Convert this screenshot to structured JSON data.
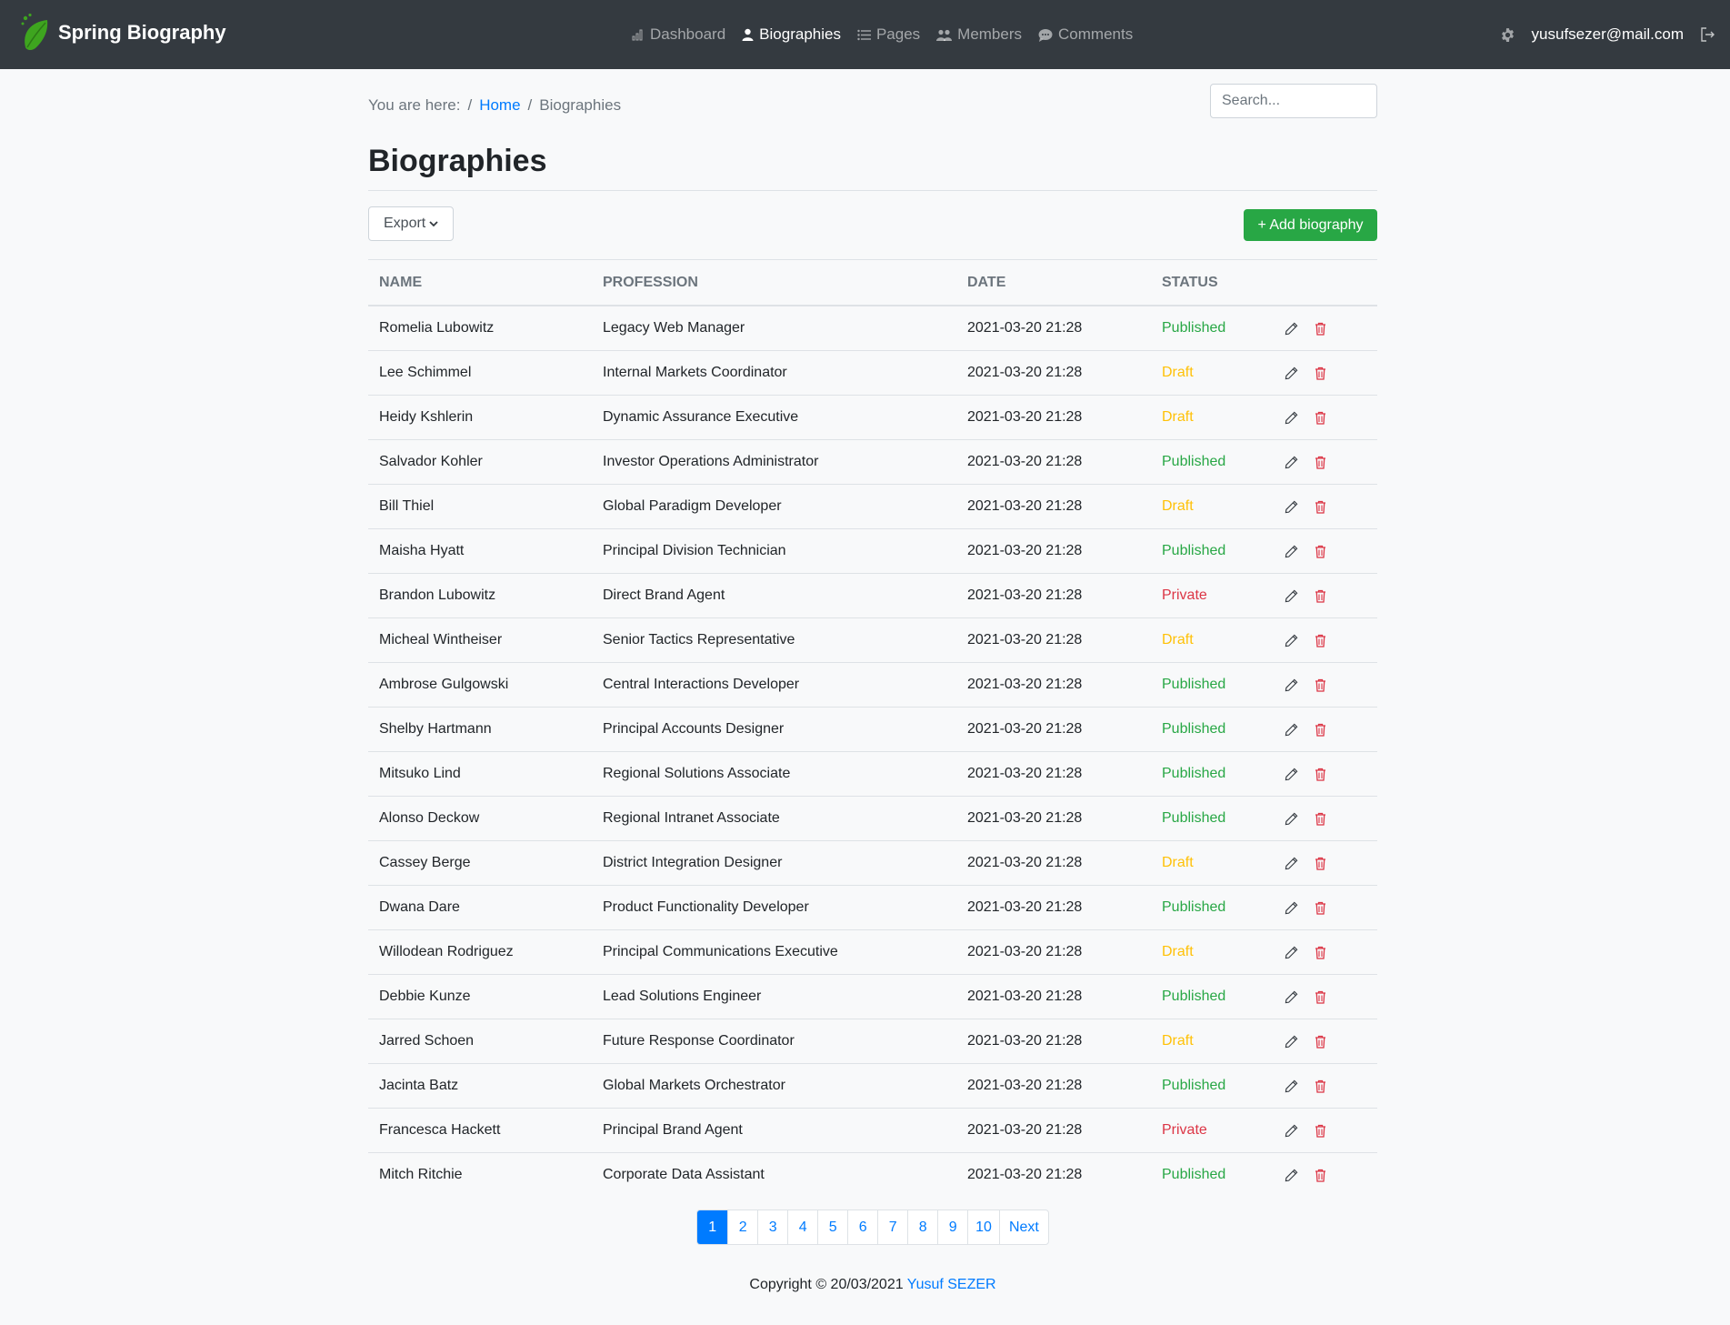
{
  "app": {
    "brand": "Spring Biography",
    "brand_leaf_color": "#3ea51f"
  },
  "nav": {
    "items": [
      {
        "label": "Dashboard",
        "icon": "chart-icon",
        "active": false
      },
      {
        "label": "Biographies",
        "icon": "person-icon",
        "active": true
      },
      {
        "label": "Pages",
        "icon": "list-icon",
        "active": false
      },
      {
        "label": "Members",
        "icon": "people-icon",
        "active": false
      },
      {
        "label": "Comments",
        "icon": "chat-icon",
        "active": false
      }
    ],
    "user_email": "yusufsezer@mail.com",
    "settings_icon": "gear-icon",
    "logout_icon": "logout-icon"
  },
  "breadcrumb": {
    "prefix": "You are here:",
    "home": "Home",
    "current": "Biographies"
  },
  "search": {
    "placeholder": "Search..."
  },
  "page": {
    "title": "Biographies"
  },
  "toolbar": {
    "export_label": "Export",
    "add_label": "+ Add biography"
  },
  "table": {
    "headers": [
      "NAME",
      "PROFESSION",
      "DATE",
      "STATUS"
    ],
    "rows": [
      {
        "name": "Romelia Lubowitz",
        "profession": "Legacy Web Manager",
        "date": "2021-03-20 21:28",
        "status": "Published"
      },
      {
        "name": "Lee Schimmel",
        "profession": "Internal Markets Coordinator",
        "date": "2021-03-20 21:28",
        "status": "Draft"
      },
      {
        "name": "Heidy Kshlerin",
        "profession": "Dynamic Assurance Executive",
        "date": "2021-03-20 21:28",
        "status": "Draft"
      },
      {
        "name": "Salvador Kohler",
        "profession": "Investor Operations Administrator",
        "date": "2021-03-20 21:28",
        "status": "Published"
      },
      {
        "name": "Bill Thiel",
        "profession": "Global Paradigm Developer",
        "date": "2021-03-20 21:28",
        "status": "Draft"
      },
      {
        "name": "Maisha Hyatt",
        "profession": "Principal Division Technician",
        "date": "2021-03-20 21:28",
        "status": "Published"
      },
      {
        "name": "Brandon Lubowitz",
        "profession": "Direct Brand Agent",
        "date": "2021-03-20 21:28",
        "status": "Private"
      },
      {
        "name": "Micheal Wintheiser",
        "profession": "Senior Tactics Representative",
        "date": "2021-03-20 21:28",
        "status": "Draft"
      },
      {
        "name": "Ambrose Gulgowski",
        "profession": "Central Interactions Developer",
        "date": "2021-03-20 21:28",
        "status": "Published"
      },
      {
        "name": "Shelby Hartmann",
        "profession": "Principal Accounts Designer",
        "date": "2021-03-20 21:28",
        "status": "Published"
      },
      {
        "name": "Mitsuko Lind",
        "profession": "Regional Solutions Associate",
        "date": "2021-03-20 21:28",
        "status": "Published"
      },
      {
        "name": "Alonso Deckow",
        "profession": "Regional Intranet Associate",
        "date": "2021-03-20 21:28",
        "status": "Published"
      },
      {
        "name": "Cassey Berge",
        "profession": "District Integration Designer",
        "date": "2021-03-20 21:28",
        "status": "Draft"
      },
      {
        "name": "Dwana Dare",
        "profession": "Product Functionality Developer",
        "date": "2021-03-20 21:28",
        "status": "Published"
      },
      {
        "name": "Willodean Rodriguez",
        "profession": "Principal Communications Executive",
        "date": "2021-03-20 21:28",
        "status": "Draft"
      },
      {
        "name": "Debbie Kunze",
        "profession": "Lead Solutions Engineer",
        "date": "2021-03-20 21:28",
        "status": "Published"
      },
      {
        "name": "Jarred Schoen",
        "profession": "Future Response Coordinator",
        "date": "2021-03-20 21:28",
        "status": "Draft"
      },
      {
        "name": "Jacinta Batz",
        "profession": "Global Markets Orchestrator",
        "date": "2021-03-20 21:28",
        "status": "Published"
      },
      {
        "name": "Francesca Hackett",
        "profession": "Principal Brand Agent",
        "date": "2021-03-20 21:28",
        "status": "Private"
      },
      {
        "name": "Mitch Ritchie",
        "profession": "Corporate Data Assistant",
        "date": "2021-03-20 21:28",
        "status": "Published"
      }
    ],
    "row_actions": [
      "pencil-icon",
      "trash-icon"
    ]
  },
  "pagination": {
    "pages": [
      "1",
      "2",
      "3",
      "4",
      "5",
      "6",
      "7",
      "8",
      "9",
      "10"
    ],
    "active": "1",
    "next_label": "Next"
  },
  "footer": {
    "text": "Copyright © 20/03/2021",
    "author": "Yusuf SEZER"
  },
  "colors": {
    "navbar": "#343a40",
    "published": "#28a745",
    "draft": "#ffc107",
    "private": "#dc3545",
    "link": "#007bff",
    "add_button": "#28a745"
  }
}
